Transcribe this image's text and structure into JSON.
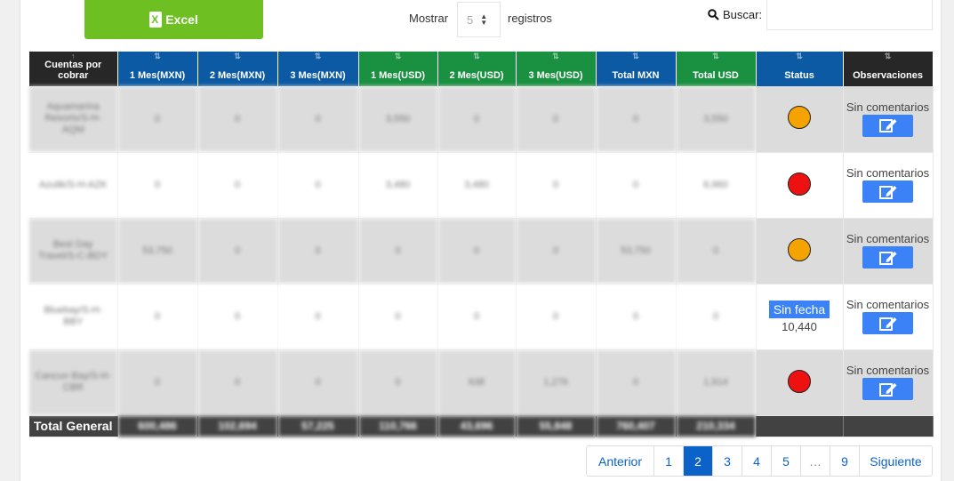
{
  "toolbar": {
    "excel_label": "Excel",
    "show_label": "Mostrar",
    "show_value": "5",
    "records_label": "registros",
    "search_label": "Buscar:",
    "search_value": ""
  },
  "table": {
    "headers": [
      "Cuentas por cobrar",
      "1 Mes(MXN)",
      "2 Mes(MXN)",
      "3 Mes(MXN)",
      "1 Mes(USD)",
      "2 Mes(USD)",
      "3 Mes(USD)",
      "Total MXN",
      "Total USD",
      "Status",
      "Observaciones"
    ],
    "rows": [
      {
        "name": "Aquamarina Resorts/S-H-AQM",
        "values": [
          "0",
          "0",
          "0",
          "3,550",
          "0",
          "0",
          "0",
          "3,550"
        ],
        "status_color": "#f5a300",
        "obs": "Sin comentarios"
      },
      {
        "name": "Azulik/S-H-AZK",
        "values": [
          "0",
          "0",
          "0",
          "3,480",
          "3,480",
          "0",
          "0",
          "6,960"
        ],
        "status_color": "#ee1111",
        "obs": "Sin comentarios"
      },
      {
        "name": "Best Day Travel/S-C-BDY",
        "values": [
          "53,750",
          "0",
          "0",
          "0",
          "0",
          "0",
          "53,750",
          "0"
        ],
        "status_color": "#f5a300",
        "obs": "Sin comentarios"
      },
      {
        "name": "Bluebay/S-H-BBY",
        "values": [
          "0",
          "0",
          "0",
          "0",
          "0",
          "0",
          "0",
          "0"
        ],
        "status_badge": "Sin fecha",
        "status_value": "10,440",
        "obs": "Sin comentarios"
      },
      {
        "name": "Cancun Bay/S-H-CBR",
        "values": [
          "0",
          "0",
          "0",
          "0",
          "638",
          "1,276",
          "0",
          "1,914"
        ],
        "status_color": "#ee1111",
        "obs": "Sin comentarios"
      }
    ],
    "total": {
      "label": "Total General",
      "values": [
        "600,486",
        "102,694",
        "57,225",
        "110,766",
        "43,696",
        "55,848",
        "760,407",
        "210,334"
      ]
    }
  },
  "pagination": {
    "prev": "Anterior",
    "pages": [
      "1",
      "2",
      "3",
      "4",
      "5",
      "…",
      "9"
    ],
    "active": "2",
    "next": "Siguiente"
  },
  "colors": {
    "excel": "#6dbf22",
    "header_blue": "#0b5aa3",
    "header_green": "#1a9041",
    "header_dark": "#272727",
    "accent": "#3b82f6"
  }
}
